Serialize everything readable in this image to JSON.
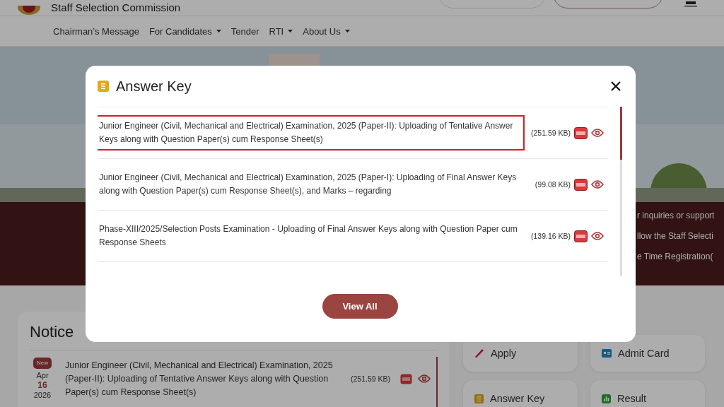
{
  "header": {
    "title": "Staff Selection Commission"
  },
  "nav": [
    {
      "label": "Chairman’s Message",
      "dropdown": false
    },
    {
      "label": "For Candidates",
      "dropdown": true
    },
    {
      "label": "Tender",
      "dropdown": false
    },
    {
      "label": "RTI",
      "dropdown": true
    },
    {
      "label": "About Us",
      "dropdown": true
    }
  ],
  "ticker": [
    "r inquiries or support",
    "llow the Staff Selecti",
    "e Time Registration("
  ],
  "notice_board": {
    "title": "Notice",
    "items": [
      {
        "badge": "New",
        "month": "Apr",
        "day": "16",
        "year": "2026",
        "text": "Junior Engineer (Civil, Mechanical and Electrical) Examination, 2025 (Paper-II): Uploading of Tentative Answer Keys along with Question Paper(s) cum Response Sheet(s)",
        "size": "(251.59 KB)"
      }
    ]
  },
  "quick_links": [
    {
      "label": "Apply",
      "kind": "apply"
    },
    {
      "label": "Admit Card",
      "kind": "admit"
    },
    {
      "label": "Answer Key",
      "kind": "key"
    },
    {
      "label": "Result",
      "kind": "result"
    }
  ],
  "modal": {
    "title": "Answer Key",
    "button": "View All",
    "items": [
      {
        "text": "Junior Engineer (Civil, Mechanical and Electrical) Examination, 2025 (Paper-II): Uploading of Tentative Answer Keys along with Question Paper(s) cum Response Sheet(s)",
        "size": "(251.59 KB)",
        "highlighted": true
      },
      {
        "text": "Junior Engineer (Civil, Mechanical and Electrical) Examination, 2025 (Paper-I): Uploading of Final Answer Keys along with Question Paper(s) cum Response Sheet(s), and Marks – regarding",
        "size": "(99.08 KB)",
        "highlighted": false
      },
      {
        "text": "Phase-XIII/2025/Selection Posts Examination - Uploading of Final Answer Keys along with Question Paper cum Response Sheets",
        "size": "(139.16 KB)",
        "highlighted": false
      }
    ]
  }
}
